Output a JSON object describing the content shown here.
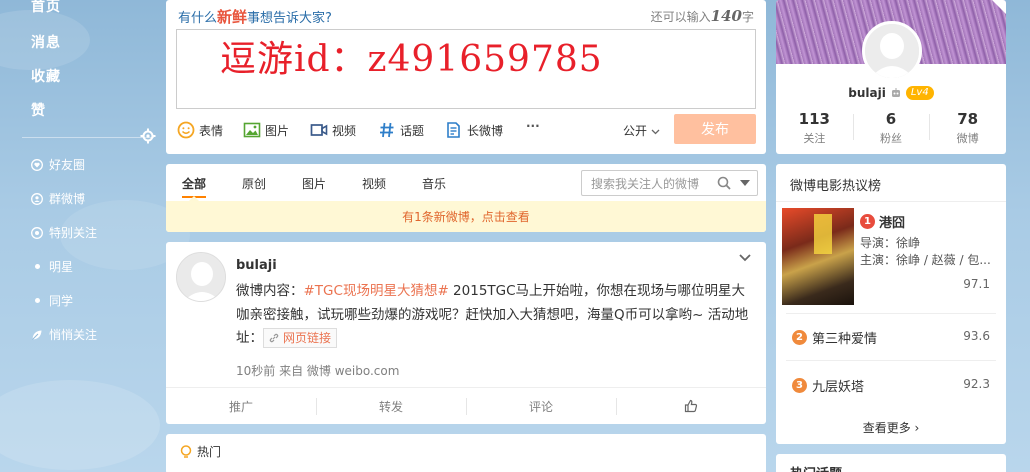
{
  "nav": {
    "home": "首页",
    "messages": "消息",
    "favorites": "收藏",
    "likes": "赞",
    "groups": [
      {
        "label": "好友圈",
        "icon": "heart-circle-icon"
      },
      {
        "label": "群微博",
        "icon": "user-circle-icon"
      },
      {
        "label": "特别关注",
        "icon": "target-icon"
      },
      {
        "label": "明星",
        "icon": "dot-icon"
      },
      {
        "label": "同学",
        "icon": "dot-icon"
      },
      {
        "label": "悄悄关注",
        "icon": "leaf-icon"
      }
    ]
  },
  "composer": {
    "prompt_pre": "有什么",
    "prompt_mid": "新鲜",
    "prompt_post": "事想告诉大家?",
    "count_pre": "还可以输入",
    "count_num": "140",
    "count_post": "字",
    "content": "逗游id：z491659785",
    "tools": {
      "emoji": "表情",
      "image": "图片",
      "video": "视频",
      "topic": "话题",
      "long_post": "长微博",
      "more": "···"
    },
    "visibility": "公开",
    "publish": "发布"
  },
  "feed_tabs": {
    "tabs": [
      "全部",
      "原创",
      "图片",
      "视频",
      "音乐"
    ],
    "search_placeholder": "搜索我关注人的微博",
    "new_notice": "有1条新微博，点击查看"
  },
  "post": {
    "user": "bulaji",
    "text_pre": "微博内容：",
    "topic": "#TGC现场明星大猜想#",
    "text_post": " 2015TGC马上开始啦，你想在现场与哪位明星大咖亲密接触，试玩哪些劲爆的游戏呢？赶快加入大猜想吧，海量Q币可以拿哟~ 活动地址：",
    "link": "网页链接",
    "meta": "10秒前 来自 微博 weibo.com",
    "actions": {
      "promote": "推广",
      "repost": "转发",
      "comment": "评论"
    }
  },
  "hot": {
    "label": "热门"
  },
  "profile": {
    "name": "bulaji",
    "level": "Lv4",
    "stats": [
      {
        "num": "113",
        "label": "关注"
      },
      {
        "num": "6",
        "label": "粉丝"
      },
      {
        "num": "78",
        "label": "微博"
      }
    ]
  },
  "movies": {
    "title": "微博电影热议榜",
    "first": {
      "rank": "1",
      "name": "港囧",
      "director": "导演：徐峥",
      "cast": "主演：徐峥 / 赵薇 / 包...",
      "score": "97.1"
    },
    "others": [
      {
        "rank": "2",
        "name": "第三种爱情",
        "score": "93.6"
      },
      {
        "rank": "3",
        "name": "九层妖塔",
        "score": "92.3"
      }
    ],
    "more": "查看更多 ›",
    "colors": {
      "rank1": "#e84c3d",
      "rank2": "#f08a3c",
      "rank3": "#f08a3c"
    }
  },
  "topics": {
    "title": "热门话题"
  }
}
